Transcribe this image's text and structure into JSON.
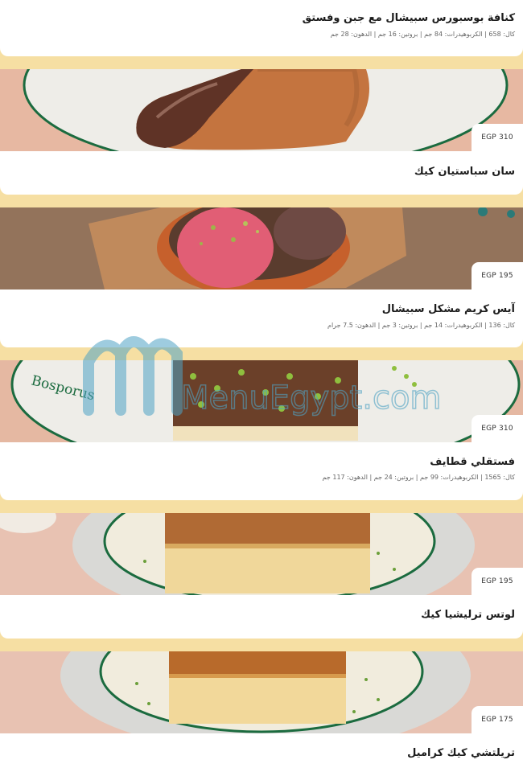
{
  "menu": {
    "items": [
      {
        "name": "كنافة بوسبورس سبيشال مع جبن وفستق",
        "nutrition": "كال: 658 | الكربوهيدرات: 84 جم | بروتين: 16 جم | الدهون: 28 جم"
      },
      {
        "name": "سان سباستيان كيك",
        "price": "EGP 310"
      },
      {
        "name": "آيس كريم مشكل سبيشال",
        "price": "EGP 195",
        "nutrition": "كال: 136 | الكربوهيدرات: 14 جم | بروتين: 3 جم | الدهون: 7.5 جرام"
      },
      {
        "name": "فستقلي قطايف",
        "price": "EGP 310",
        "nutrition": "كال: 1565 | الكربوهيدرات: 99 جم | بروتين: 24 جم | الدهون: 117 جم"
      },
      {
        "name": "لوتس ترليشيا كيك",
        "price": "EGP 195"
      },
      {
        "name": "تريلتشي كيك كراميل",
        "price": "EGP 175"
      }
    ]
  },
  "plate_text": "Bosporus",
  "watermark": "MenuEgypt.com"
}
